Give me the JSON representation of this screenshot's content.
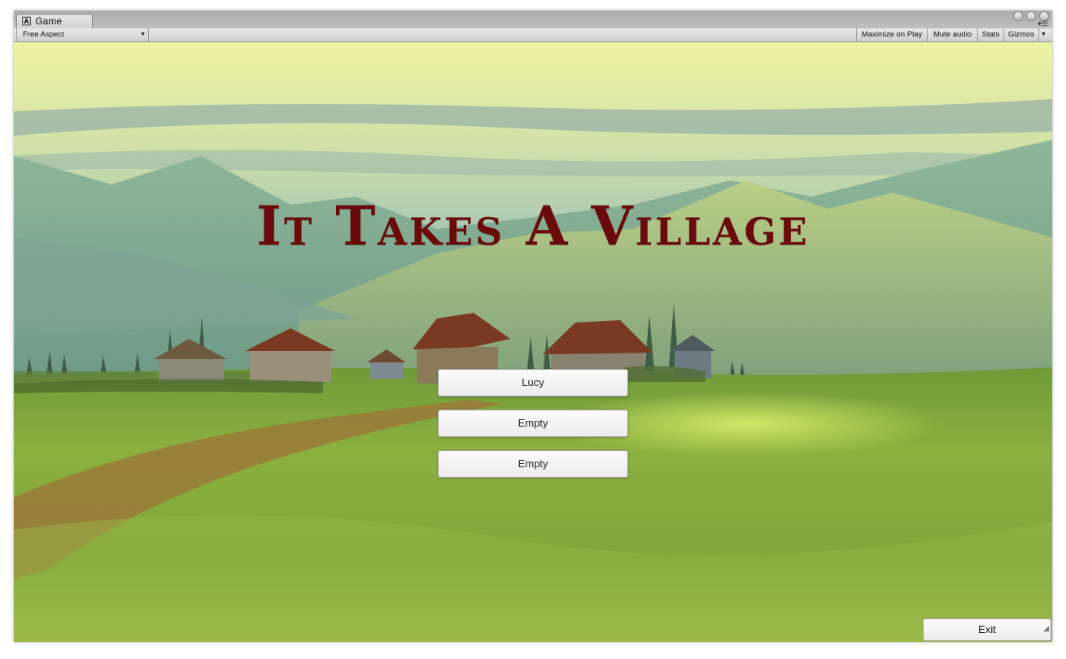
{
  "window": {
    "tab_title": "Game",
    "tab_icon": "unity-icon",
    "menu_glyph": "▾☰"
  },
  "toolbar": {
    "aspect_dropdown": "Free Aspect",
    "maximize_on_play": "Maximize on Play",
    "mute_audio": "Mute audio",
    "stats": "Stats",
    "gizmos": "Gizmos"
  },
  "game": {
    "title": "It Takes A Village",
    "save_slots": [
      "Lucy",
      "Empty",
      "Empty"
    ],
    "exit_label": "Exit"
  },
  "colors": {
    "title": "#6b0a0a",
    "sky_top": "#eef3a2",
    "grass": "#7fa53a"
  }
}
